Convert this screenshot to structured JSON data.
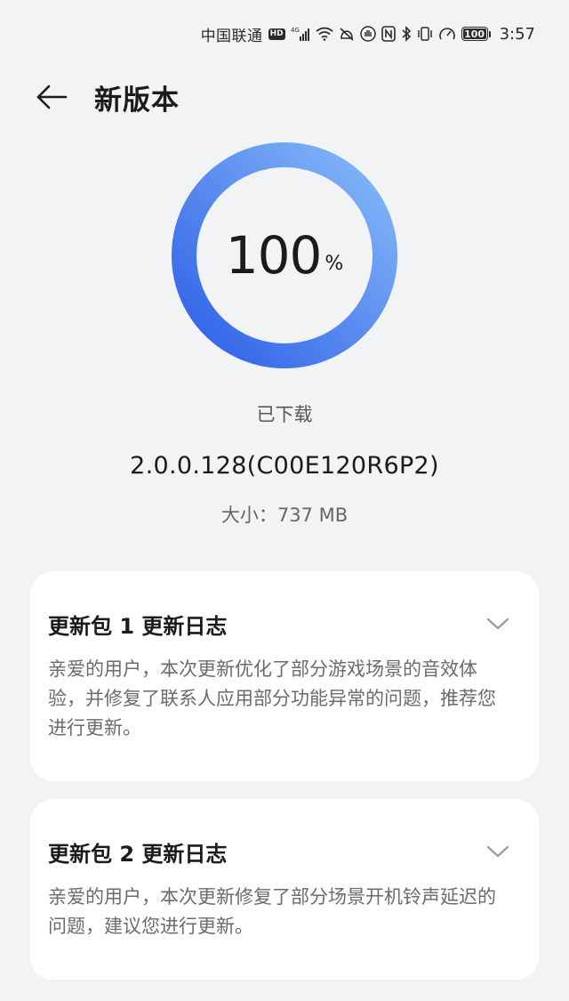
{
  "status_bar": {
    "carrier": "中国联通",
    "hd": "HD",
    "network": "4G",
    "battery": "100",
    "time": "3:57"
  },
  "header": {
    "title": "新版本"
  },
  "progress": {
    "value": "100",
    "unit": "%",
    "fraction": 1.0,
    "colors": {
      "start": "#2e5fe8",
      "end": "#86baf7"
    }
  },
  "download": {
    "status": "已下载",
    "version": "2.0.0.128(C00E120R6P2)",
    "size": "大小：737 MB"
  },
  "changelogs": [
    {
      "title": "更新包 1 更新日志",
      "body": "亲爱的用户，本次更新优化了部分游戏场景的音效体验，并修复了联系人应用部分功能异常的问题，推荐您进行更新。"
    },
    {
      "title": "更新包 2 更新日志",
      "body": "亲爱的用户，本次更新修复了部分场景开机铃声延迟的问题，建议您进行更新。"
    }
  ],
  "icons": {
    "back": "arrow-left-icon",
    "expand": "chevron-down-icon"
  }
}
